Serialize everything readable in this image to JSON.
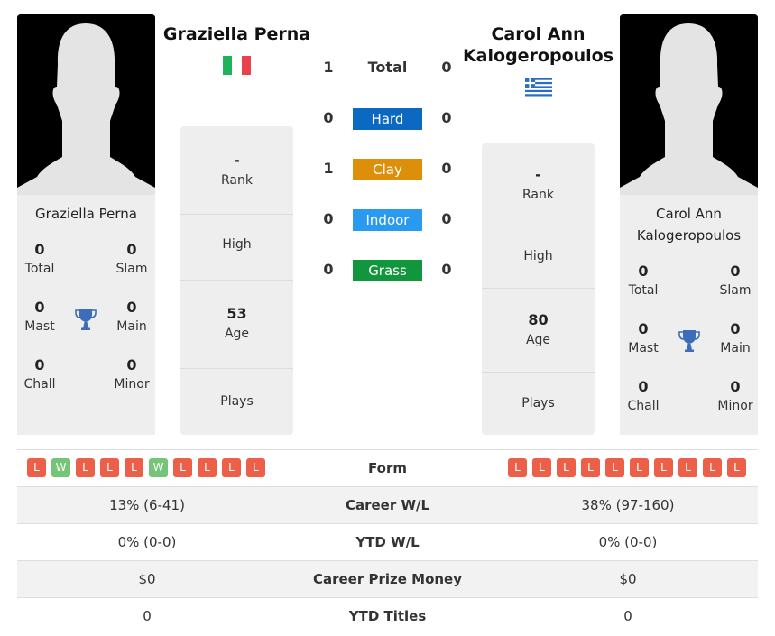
{
  "player1": {
    "name": "Graziella Perna",
    "card_name": "Graziella Perna",
    "country": "Italy",
    "flag_icon": "italy-flag-icon",
    "titles": {
      "total": {
        "value": "0",
        "label": "Total"
      },
      "slam": {
        "value": "0",
        "label": "Slam"
      },
      "mast": {
        "value": "0",
        "label": "Mast"
      },
      "main": {
        "value": "0",
        "label": "Main"
      },
      "chall": {
        "value": "0",
        "label": "Chall"
      },
      "minor": {
        "value": "0",
        "label": "Minor"
      }
    },
    "info": {
      "rank": {
        "value": "-",
        "label": "Rank"
      },
      "high": {
        "value": "",
        "label": "High"
      },
      "age": {
        "value": "53",
        "label": "Age"
      },
      "plays": {
        "value": "",
        "label": "Plays"
      }
    },
    "form": [
      "L",
      "W",
      "L",
      "L",
      "L",
      "W",
      "L",
      "L",
      "L",
      "L"
    ],
    "career_wl": "13% (6-41)",
    "ytd_wl": "0% (0-0)",
    "prize_money": "$0",
    "ytd_titles": "0"
  },
  "player2": {
    "name_line1": "Carol Ann",
    "name_line2": "Kalogeropoulos",
    "card_name_line1": "Carol Ann",
    "card_name_line2": "Kalogeropoulos",
    "country": "Greece",
    "flag_icon": "greece-flag-icon",
    "titles": {
      "total": {
        "value": "0",
        "label": "Total"
      },
      "slam": {
        "value": "0",
        "label": "Slam"
      },
      "mast": {
        "value": "0",
        "label": "Mast"
      },
      "main": {
        "value": "0",
        "label": "Main"
      },
      "chall": {
        "value": "0",
        "label": "Chall"
      },
      "minor": {
        "value": "0",
        "label": "Minor"
      }
    },
    "info": {
      "rank": {
        "value": "-",
        "label": "Rank"
      },
      "high": {
        "value": "",
        "label": "High"
      },
      "age": {
        "value": "80",
        "label": "Age"
      },
      "plays": {
        "value": "",
        "label": "Plays"
      }
    },
    "form": [
      "L",
      "L",
      "L",
      "L",
      "L",
      "L",
      "L",
      "L",
      "L",
      "L"
    ],
    "career_wl": "38% (97-160)",
    "ytd_wl": "0% (0-0)",
    "prize_money": "$0",
    "ytd_titles": "0"
  },
  "h2h": {
    "total": {
      "label": "Total",
      "p1": "1",
      "p2": "0"
    },
    "surfaces": [
      {
        "label": "Hard",
        "p1": "0",
        "p2": "0",
        "color": "#0b69c1"
      },
      {
        "label": "Clay",
        "p1": "1",
        "p2": "0",
        "color": "#dd8f0a"
      },
      {
        "label": "Indoor",
        "p1": "0",
        "p2": "0",
        "color": "#2a9af0"
      },
      {
        "label": "Grass",
        "p1": "0",
        "p2": "0",
        "color": "#12963d"
      }
    ]
  },
  "comparison": {
    "form_label": "Form",
    "career_wl_label": "Career W/L",
    "ytd_wl_label": "YTD W/L",
    "prize_label": "Career Prize Money",
    "ytd_titles_label": "YTD Titles"
  },
  "colors": {
    "loss": "#ec6049",
    "win": "#76c477",
    "trophy": "#3d6cb9"
  }
}
